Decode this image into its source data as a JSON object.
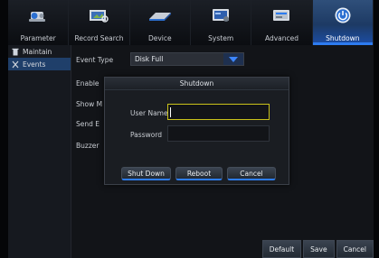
{
  "tabs": [
    {
      "label": "Parameter",
      "icon": "camera-icon",
      "active": false
    },
    {
      "label": "Record Search",
      "icon": "video-search-icon",
      "active": false
    },
    {
      "label": "Device",
      "icon": "hdd-icon",
      "active": false
    },
    {
      "label": "System",
      "icon": "monitor-settings-icon",
      "active": false
    },
    {
      "label": "Advanced",
      "icon": "advanced-settings-icon",
      "active": false
    },
    {
      "label": "Shutdown",
      "icon": "power-icon",
      "active": true
    }
  ],
  "sidebar": {
    "items": [
      {
        "label": "Maintain",
        "icon": "trash-icon",
        "active": false
      },
      {
        "label": "Events",
        "icon": "tools-icon",
        "active": true
      }
    ]
  },
  "content": {
    "event_type_label": "Event Type",
    "event_type_value": "Disk Full",
    "enable_label": "Enable",
    "show_label": "Show M",
    "send_label": "Send E",
    "buzzer_label": "Buzzer"
  },
  "dialog": {
    "title": "Shutdown",
    "username_label": "User Name",
    "username_value": "",
    "password_label": "Password",
    "password_value": "",
    "shutdown_button": "Shut Down",
    "reboot_button": "Reboot",
    "cancel_button": "Cancel"
  },
  "bottom_buttons": {
    "default": "Default",
    "save": "Save",
    "cancel": "Cancel"
  },
  "colors": {
    "accent_blue": "#2d7cf0",
    "focus_yellow": "#c9c21a",
    "background": "#0a0c10"
  }
}
